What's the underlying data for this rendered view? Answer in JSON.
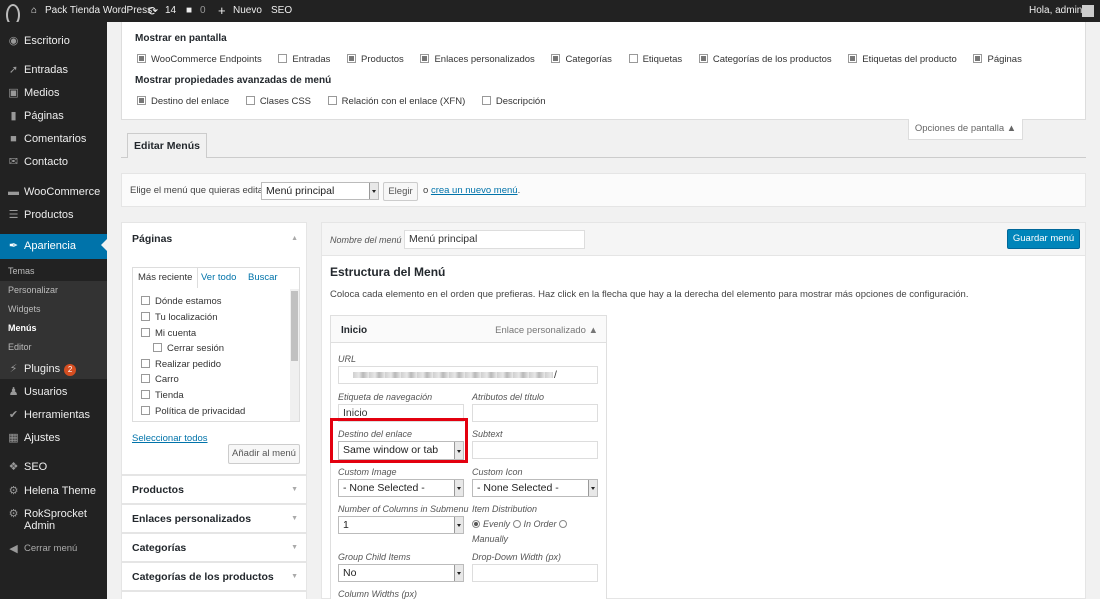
{
  "admin_bar": {
    "site_name": "Pack Tienda WordPress",
    "updates_count": "14",
    "comments_count": "0",
    "new_label": "Nuevo",
    "seo_label": "SEO",
    "greeting": "Hola, admin"
  },
  "sidebar": {
    "items": [
      {
        "label": "Escritorio",
        "icon": "dashboard-icon"
      },
      {
        "label": "Entradas",
        "icon": "pin-icon"
      },
      {
        "label": "Medios",
        "icon": "media-icon"
      },
      {
        "label": "Páginas",
        "icon": "page-icon"
      },
      {
        "label": "Comentarios",
        "icon": "comment-icon"
      },
      {
        "label": "Contacto",
        "icon": "mail-icon"
      },
      {
        "label": "WooCommerce",
        "icon": "woocommerce-icon"
      },
      {
        "label": "Productos",
        "icon": "cart-icon"
      },
      {
        "label": "Apariencia",
        "icon": "brush-icon"
      },
      {
        "label": "Plugins",
        "icon": "plugin-icon",
        "badge": "2"
      },
      {
        "label": "Usuarios",
        "icon": "users-icon"
      },
      {
        "label": "Herramientas",
        "icon": "wrench-icon"
      },
      {
        "label": "Ajustes",
        "icon": "settings-icon"
      },
      {
        "label": "SEO",
        "icon": "seo-icon"
      },
      {
        "label": "Helena Theme",
        "icon": "gear-icon"
      },
      {
        "label": "RokSprocket",
        "label2": "Admin",
        "icon": "rocket-icon"
      },
      {
        "label": "Cerrar menú",
        "icon": "collapse-icon"
      }
    ],
    "submenu": [
      "Temas",
      "Personalizar",
      "Widgets",
      "Menús",
      "Editor"
    ],
    "active_color": "#0073aa"
  },
  "screen_options": {
    "heading1": "Mostrar en pantalla",
    "boxes": [
      {
        "label": "WooCommerce Endpoints",
        "checked": true
      },
      {
        "label": "Entradas",
        "checked": false
      },
      {
        "label": "Productos",
        "checked": true
      },
      {
        "label": "Enlaces personalizados",
        "checked": true
      },
      {
        "label": "Categorías",
        "checked": true
      },
      {
        "label": "Etiquetas",
        "checked": false
      },
      {
        "label": "Categorías de los productos",
        "checked": true
      },
      {
        "label": "Etiquetas del producto",
        "checked": true
      },
      {
        "label": "Páginas",
        "checked": true
      }
    ],
    "heading2": "Mostrar propiedades avanzadas de menú",
    "advanced": [
      {
        "label": "Destino del enlace",
        "checked": true
      },
      {
        "label": "Clases CSS",
        "checked": false
      },
      {
        "label": "Relación con el enlace (XFN)",
        "checked": false
      },
      {
        "label": "Descripción",
        "checked": false
      }
    ],
    "tab_label": "Opciones de pantalla ▲"
  },
  "nav_tab": "Editar Menús",
  "manage": {
    "label": "Elige el menú que quieras editar:",
    "selected_menu": "Menú principal",
    "select_button": "Elegir",
    "or_text": "o",
    "create_link": "crea un nuevo menú",
    "period": "."
  },
  "pages_box": {
    "title": "Páginas",
    "toggle": "▲",
    "tabs": [
      "Más reciente",
      "Ver todo",
      "Buscar"
    ],
    "pages": [
      {
        "label": "Dónde estamos",
        "indent": false
      },
      {
        "label": "Tu localización",
        "indent": false
      },
      {
        "label": "Mi cuenta",
        "indent": false
      },
      {
        "label": "Cerrar sesión",
        "indent": true
      },
      {
        "label": "Realizar pedido",
        "indent": false
      },
      {
        "label": "Carro",
        "indent": false
      },
      {
        "label": "Tienda",
        "indent": false
      },
      {
        "label": "Política de privacidad",
        "indent": false
      }
    ],
    "select_all": "Seleccionar todos",
    "add_button": "Añadir al menú"
  },
  "accordion": [
    {
      "title": "Productos",
      "toggle": "▼"
    },
    {
      "title": "Enlaces personalizados",
      "toggle": "▼"
    },
    {
      "title": "Categorías",
      "toggle": "▼"
    },
    {
      "title": "Categorías de los productos",
      "toggle": "▼"
    }
  ],
  "menu_editor": {
    "name_label": "Nombre del menú",
    "name_value": "Menú principal",
    "save_button": "Guardar menú",
    "structure_title": "Estructura del Menú",
    "structure_desc": "Coloca cada elemento en el orden que prefieras. Haz click en la flecha que hay a la derecha del elemento para mostrar más opciones de configuración.",
    "item": {
      "title": "Inicio",
      "type": "Enlace personalizado ▲",
      "url_label": "URL",
      "url_value": "/",
      "nav_label_label": "Etiqueta de navegación",
      "nav_label_value": "Inicio",
      "title_attr_label": "Atributos del título",
      "target_label": "Destino del enlace",
      "target_value": "Same window or tab",
      "subtext_label": "Subtext",
      "custom_image_label": "Custom Image",
      "custom_image_value": "- None Selected -",
      "custom_icon_label": "Custom Icon",
      "custom_icon_value": "- None Selected -",
      "columns_label": "Number of Columns in Submenu",
      "columns_value": "1",
      "distribution_label": "Item Distribution",
      "dist_evenly": "Evenly",
      "dist_in_order": "In Order",
      "dist_manually": "Manually",
      "group_label": "Group Child Items",
      "group_value": "No",
      "dropdown_width_label": "Drop-Down Width (px)",
      "column_widths_label": "Column Widths (px)"
    }
  },
  "highlight_color": "#e3000f"
}
